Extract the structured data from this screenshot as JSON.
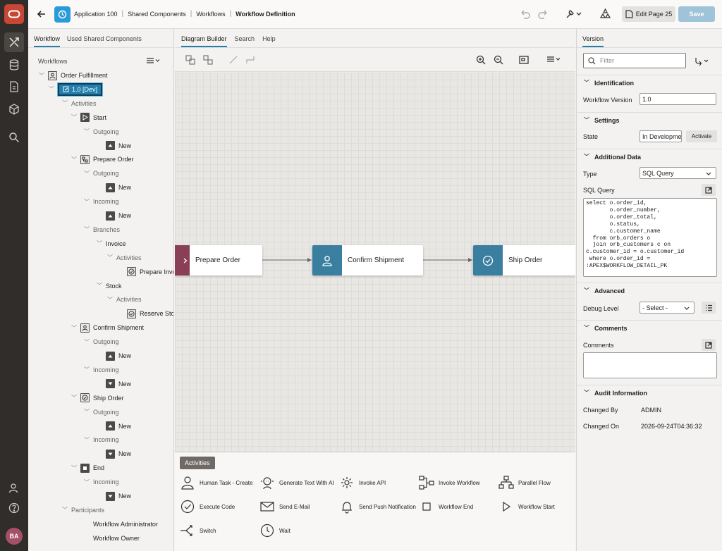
{
  "breadcrumb": [
    "Application 100",
    "Shared Components",
    "Workflows",
    "Workflow Definition"
  ],
  "toolbar": {
    "edit_page": "Edit Page 25",
    "save": "Save"
  },
  "left": {
    "tabs": [
      "Workflow",
      "Used Shared Components"
    ],
    "section": "Workflows",
    "tree": [
      {
        "t": "Order Fulfillment",
        "d": 0,
        "icon": "workflow"
      },
      {
        "t": "1.0 [Dev]",
        "d": 1,
        "icon": "version",
        "sel": true
      },
      {
        "t": "Activities",
        "d": 2,
        "muted": true
      },
      {
        "t": "Start",
        "d": 3,
        "icon": "play"
      },
      {
        "t": "Outgoing",
        "d": 4,
        "muted": true
      },
      {
        "t": "New",
        "d": 5,
        "icon": "up"
      },
      {
        "t": "Prepare Order",
        "d": 3,
        "icon": "flow"
      },
      {
        "t": "Outgoing",
        "d": 4,
        "muted": true
      },
      {
        "t": "New",
        "d": 5,
        "icon": "up"
      },
      {
        "t": "Incoming",
        "d": 4,
        "muted": true
      },
      {
        "t": "New",
        "d": 5,
        "icon": "up"
      },
      {
        "t": "Branches",
        "d": 4,
        "muted": true
      },
      {
        "t": "Invoice",
        "d": 5
      },
      {
        "t": "Activities",
        "d": 6,
        "muted": true
      },
      {
        "t": "Prepare Invoice",
        "d": 7,
        "icon": "check"
      },
      {
        "t": "Stock",
        "d": 5
      },
      {
        "t": "Activities",
        "d": 6,
        "muted": true
      },
      {
        "t": "Reserve Stock",
        "d": 7,
        "icon": "check"
      },
      {
        "t": "Confirm Shipment",
        "d": 3,
        "icon": "user"
      },
      {
        "t": "Outgoing",
        "d": 4,
        "muted": true
      },
      {
        "t": "New",
        "d": 5,
        "icon": "up"
      },
      {
        "t": "Incoming",
        "d": 4,
        "muted": true
      },
      {
        "t": "New",
        "d": 5,
        "icon": "down"
      },
      {
        "t": "Ship Order",
        "d": 3,
        "icon": "check"
      },
      {
        "t": "Outgoing",
        "d": 4,
        "muted": true
      },
      {
        "t": "New",
        "d": 5,
        "icon": "up"
      },
      {
        "t": "Incoming",
        "d": 4,
        "muted": true
      },
      {
        "t": "New",
        "d": 5,
        "icon": "down"
      },
      {
        "t": "End",
        "d": 3,
        "icon": "stop"
      },
      {
        "t": "Incoming",
        "d": 4,
        "muted": true
      },
      {
        "t": "New",
        "d": 5,
        "icon": "down"
      },
      {
        "t": "Participants",
        "d": 2,
        "muted": true
      },
      {
        "t": "Workflow Administrator",
        "d": 4
      },
      {
        "t": "Workflow Owner",
        "d": 4
      }
    ]
  },
  "center": {
    "tabs": [
      "Diagram Builder",
      "Search",
      "Help"
    ],
    "nodes": {
      "prepare": "Prepare Order",
      "confirm": "Confirm Shipment",
      "ship": "Ship Order"
    },
    "palette_title": "Activities",
    "palette": [
      {
        "label": "Human Task - Create",
        "icon": "person"
      },
      {
        "label": "Generate Text With AI",
        "icon": "ai"
      },
      {
        "label": "Invoke API",
        "icon": "gear"
      },
      {
        "label": "Invoke Workflow",
        "icon": "workflow"
      },
      {
        "label": "Parallel Flow",
        "icon": "parallel"
      },
      {
        "label": "Execute Code",
        "icon": "check"
      },
      {
        "label": "Send E-Mail",
        "icon": "mail"
      },
      {
        "label": "Send Push Notification",
        "icon": "bell"
      },
      {
        "label": "Workflow End",
        "icon": "stop"
      },
      {
        "label": "Workflow Start",
        "icon": "play"
      },
      {
        "label": "Switch",
        "icon": "switch"
      },
      {
        "label": "Wait",
        "icon": "clock"
      }
    ]
  },
  "right": {
    "tab": "Version",
    "filter_placeholder": "Filter",
    "identification": "Identification",
    "workflow_version_label": "Workflow Version",
    "workflow_version": "1.0",
    "settings": "Settings",
    "state_label": "State",
    "state": "In Development",
    "activate": "Activate",
    "additional": "Additional Data",
    "type_label": "Type",
    "type": "SQL Query",
    "sql_label": "SQL Query",
    "sql": "select o.order_id,\n       o.order_number,\n       o.order_total,\n       o.status,\n       c.customer_name\n  from orb_orders o\n  join orb_customers c on\nc.customer_id = o.customer_id\n where o.order_id =\n:APEX$WORKFLOW_DETAIL_PK",
    "advanced": "Advanced",
    "debug_label": "Debug Level",
    "debug": "- Select -",
    "comments_section": "Comments",
    "comments_label": "Comments",
    "audit": "Audit Information",
    "changed_by_label": "Changed By",
    "changed_by": "ADMIN",
    "changed_on_label": "Changed On",
    "changed_on": "2026-09-24T04:36:32"
  },
  "user_initials": "BA"
}
